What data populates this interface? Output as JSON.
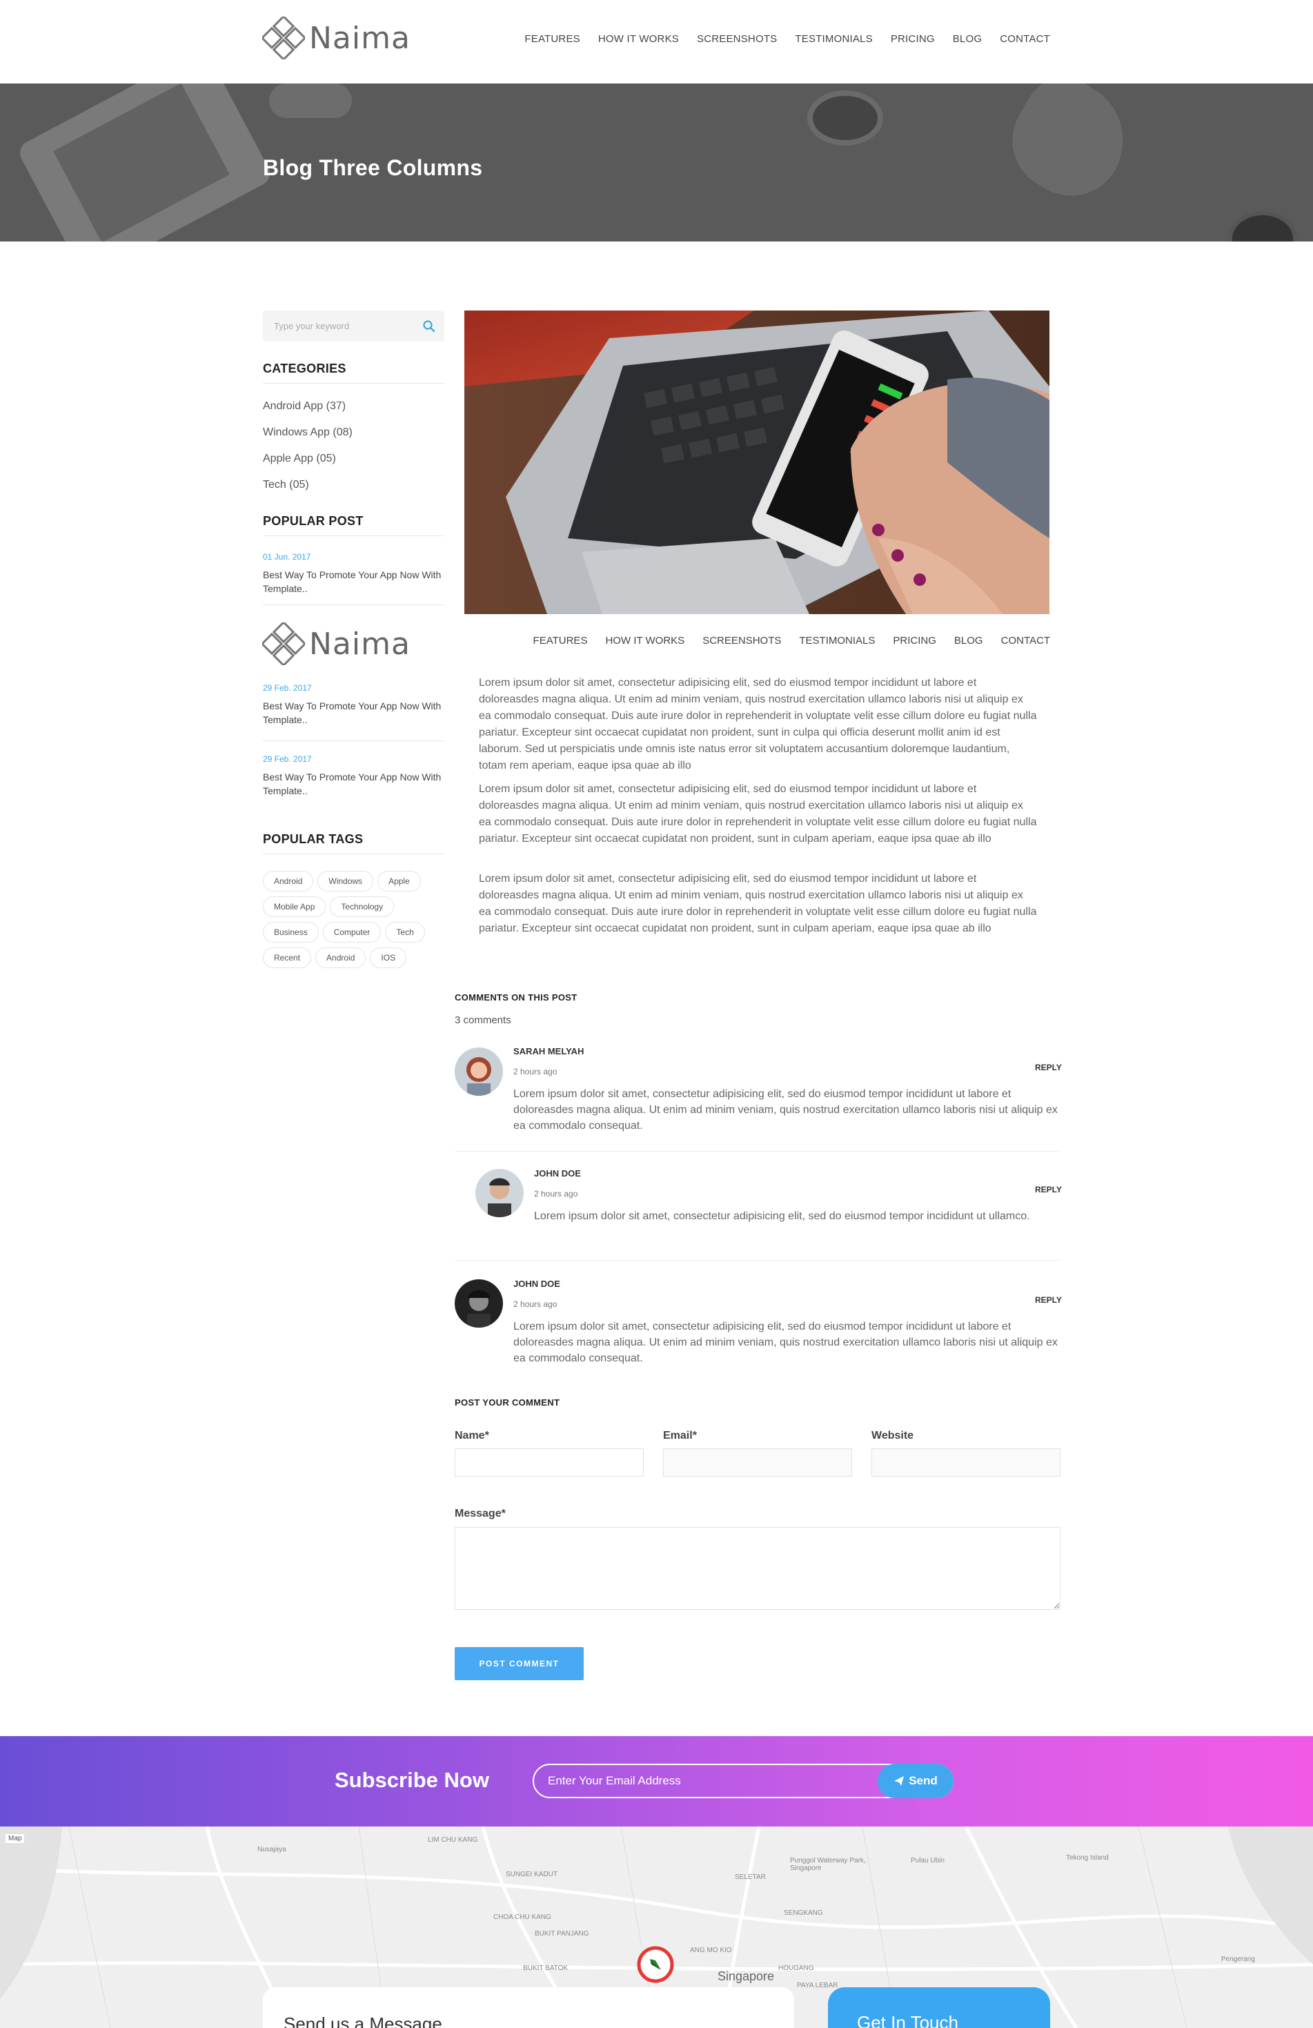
{
  "header": {
    "logo_text": "Naima",
    "nav": [
      "FEATURES",
      "HOW IT WORKS",
      "SCREENSHOTS",
      "TESTIMONIALS",
      "PRICING",
      "BLOG",
      "CONTACT"
    ]
  },
  "hero": {
    "title": "Blog Three Columns"
  },
  "sidebar": {
    "search_placeholder": "Type your keyword",
    "categories_title": "CATEGORIES",
    "categories": [
      "Android App (37)",
      "Windows App (08)",
      "Apple App (05)",
      "Tech (05)"
    ],
    "popular_title": "POPULAR POST",
    "posts": [
      {
        "date": "01 Jun. 2017",
        "title": "Best Way To Promote Your App Now With Template.."
      },
      {
        "date": "29 Feb. 2017",
        "title": "Best Way To Promote Your App Now With Template.."
      },
      {
        "date": "29 Feb. 2017",
        "title": "Best Way To Promote Your App Now With Template.."
      }
    ],
    "tags_title": "POPULAR TAGS",
    "tags": [
      "Android",
      "Windows",
      "Apple",
      "Mobile App",
      "Technology",
      "Business",
      "Computer",
      "Tech",
      "Recent",
      "Android",
      "IOS"
    ]
  },
  "article": {
    "p1": "Lorem ipsum dolor sit amet, consectetur adipisicing elit, sed do eiusmod tempor incididunt ut labore et doloreasdes magna aliqua. Ut enim ad minim veniam, quis nostrud exercitation ullamco laboris nisi ut aliquip ex ea commodalo consequat. Duis aute irure dolor in reprehenderit in voluptate velit esse cillum dolore eu fugiat nulla pariatur. Excepteur sint occaecat cupidatat non proident, sunt in culpa qui officia deserunt mollit anim id est laborum. Sed ut perspiciatis unde omnis iste natus error sit voluptatem accusantium doloremque laudantium, totam rem aperiam, eaque ipsa quae ab illo",
    "p2": "Lorem ipsum dolor sit amet, consectetur adipisicing elit, sed do eiusmod tempor incididunt ut labore et doloreasdes magna aliqua. Ut enim ad minim veniam, quis nostrud exercitation ullamco laboris nisi ut aliquip ex ea commodalo consequat. Duis aute irure dolor in reprehenderit in voluptate velit esse cillum dolore eu fugiat nulla pariatur. Excepteur sint occaecat cupidatat non proident, sunt in culpam aperiam, eaque ipsa quae ab illo",
    "p3": "Lorem ipsum dolor sit amet, consectetur adipisicing elit, sed do eiusmod tempor incididunt ut labore et doloreasdes magna aliqua. Ut enim ad minim veniam, quis nostrud exercitation ullamco laboris nisi ut aliquip ex ea commodalo consequat. Duis aute irure dolor in reprehenderit in voluptate velit esse cillum dolore eu fugiat nulla pariatur. Excepteur sint occaecat cupidatat non proident, sunt in culpam aperiam, eaque ipsa quae ab illo"
  },
  "comments": {
    "heading": "COMMENTS ON THIS POST",
    "count": "3 comments",
    "reply_label": "REPLY",
    "items": [
      {
        "name": "SARAH MELYAH",
        "time": "2 hours ago",
        "text": "Lorem ipsum dolor sit amet, consectetur adipisicing elit, sed do eiusmod tempor incididunt ut labore et doloreasdes magna aliqua. Ut enim ad minim veniam, quis nostrud exercitation ullamco laboris nisi ut aliquip ex ea commodalo consequat."
      },
      {
        "name": "JOHN DOE",
        "time": "2 hours ago",
        "text": "Lorem ipsum dolor sit amet, consectetur adipisicing elit, sed do eiusmod tempor incididunt ut ullamco."
      },
      {
        "name": "JOHN DOE",
        "time": "2 hours ago",
        "text": "Lorem ipsum dolor sit amet, consectetur adipisicing elit, sed do eiusmod tempor incididunt ut labore et doloreasdes magna aliqua. Ut enim ad minim veniam, quis nostrud exercitation ullamco laboris nisi ut aliquip ex ea commodalo consequat."
      }
    ]
  },
  "form": {
    "title": "POST YOUR COMMENT",
    "name_label": "Name*",
    "email_label": "Email*",
    "website_label": "Website",
    "message_label": "Message*",
    "submit_label": "POST COMMENT"
  },
  "subscribe": {
    "title": "Subscribe Now",
    "placeholder": "Enter Your Email Address",
    "button_label": "Send"
  },
  "map": {
    "labels": [
      "Nusajaya",
      "Pulau Ubin",
      "Tekong Island",
      "Punggol Waterway Park, Singapore",
      "SELETAR",
      "SENGKANG",
      "HOUGANG",
      "BUKIT PANJANG",
      "BUKIT BATOK",
      "Singapore",
      "Pengerang",
      "ANG MO KIO",
      "PAYA LEBAR",
      "CHOA CHU KANG",
      "SUNGEI KADUT",
      "LIM CHU KANG"
    ],
    "type_toggle": "Map"
  },
  "footer": {
    "send_message": "Send us a Message",
    "get_in_touch": "Get In Touch"
  },
  "colors": {
    "accent": "#4aa9f3",
    "date_blue": "#3aa7e8",
    "gradient_start": "#6a4fd6",
    "gradient_end": "#f25ae6"
  }
}
